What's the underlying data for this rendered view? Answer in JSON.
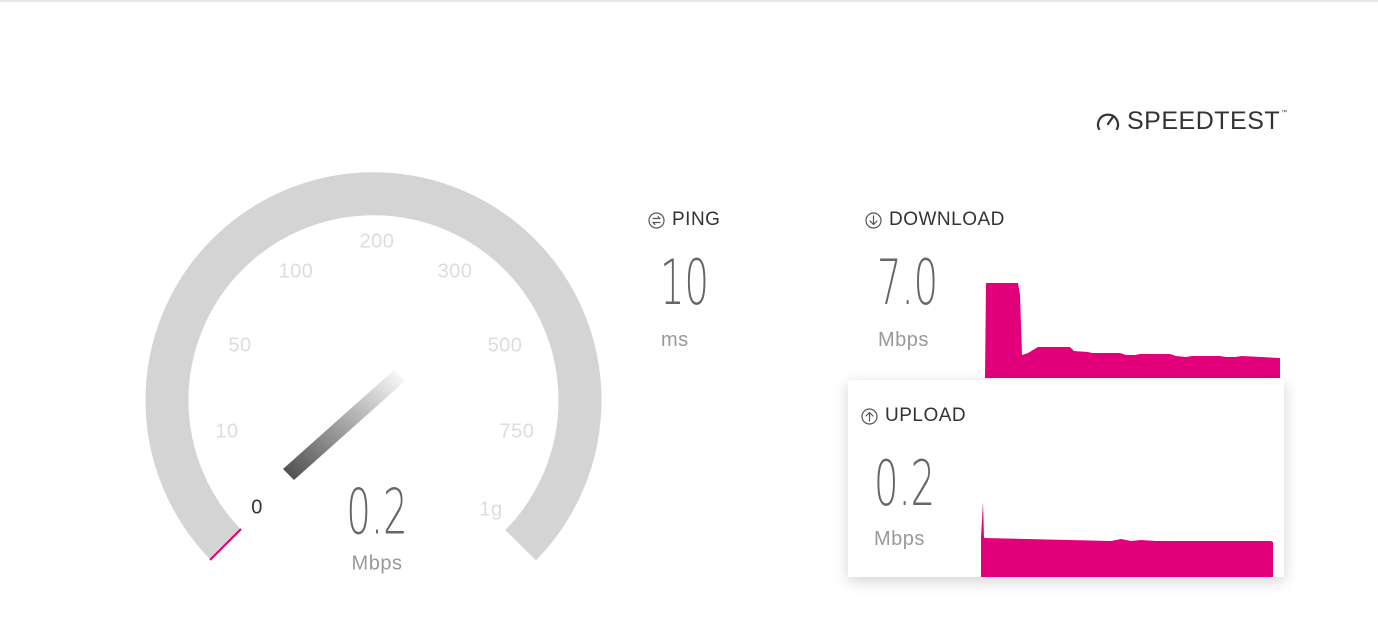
{
  "brand": {
    "name": "SPEEDTEST",
    "icon": "speedometer-icon"
  },
  "gauge": {
    "ticks": [
      "0",
      "10",
      "50",
      "100",
      "200",
      "300",
      "500",
      "750",
      "1g"
    ],
    "value": "0.2",
    "unit": "Mbps",
    "needle_value": 0.2,
    "colors": {
      "track": "#d4d4d4",
      "progress": "#e2007a"
    }
  },
  "ping": {
    "label": "PING",
    "value": "10",
    "unit": "ms",
    "icon": "ping-icon"
  },
  "download": {
    "label": "DOWNLOAD",
    "value": "7.0",
    "unit": "Mbps",
    "icon": "arrow-down-circle-icon",
    "color": "#e2007a"
  },
  "upload": {
    "label": "UPLOAD",
    "value": "0.2",
    "unit": "Mbps",
    "icon": "arrow-up-circle-icon",
    "color": "#e2007a"
  }
}
